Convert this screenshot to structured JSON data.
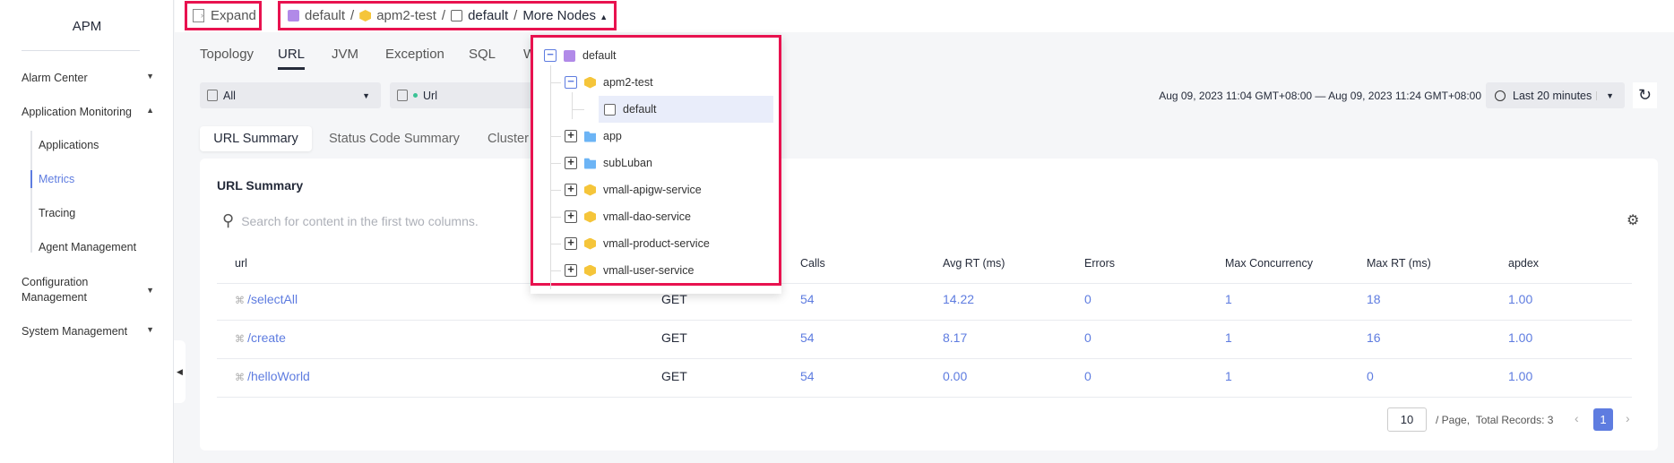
{
  "sidebar": {
    "title": "APM",
    "items": [
      {
        "label": "Alarm Center",
        "arrow": "▼"
      },
      {
        "label": "Application Monitoring",
        "arrow": "▲"
      },
      {
        "label": "Configuration Management",
        "arrow": "▼"
      },
      {
        "label": "System Management",
        "arrow": "▼"
      }
    ],
    "sub_items": [
      {
        "label": "Applications"
      },
      {
        "label": "Metrics",
        "active": true
      },
      {
        "label": "Tracing"
      },
      {
        "label": "Agent Management"
      }
    ]
  },
  "topbar": {
    "expand_label": "Expand",
    "breadcrumb": [
      {
        "label": "default",
        "icon": "environment-icon"
      },
      {
        "label": "apm2-test",
        "icon": "component-icon"
      },
      {
        "label": "default",
        "icon": "instance-icon"
      }
    ],
    "separator": "/",
    "more_nodes": "More Nodes"
  },
  "tabs": [
    {
      "label": "Topology"
    },
    {
      "label": "URL",
      "active": true
    },
    {
      "label": "JVM"
    },
    {
      "label": "Exception"
    },
    {
      "label": "SQL"
    },
    {
      "label": "W"
    }
  ],
  "filters": {
    "instance": "All",
    "type": "Url",
    "time_range": "Aug 09, 2023 11:04 GMT+08:00 — Aug 09, 2023 11:24 GMT+08:00",
    "time_preset": "Last 20 minutes"
  },
  "subtabs": [
    {
      "label": "URL Summary",
      "active": true
    },
    {
      "label": "Status Code Summary"
    },
    {
      "label": "Cluster"
    }
  ],
  "card": {
    "title": "URL Summary",
    "search_placeholder": "Search for content in the first two columns."
  },
  "table": {
    "columns": [
      "url",
      "Calls",
      "Avg RT (ms)",
      "Errors",
      "Max Concurrency",
      "Max RT (ms)",
      "apdex"
    ],
    "rows": [
      {
        "url": "/selectAll",
        "method": "GET",
        "calls": "54",
        "avg_rt": "14.22",
        "errors": "0",
        "max_conc": "1",
        "max_rt": "18",
        "apdex": "1.00"
      },
      {
        "url": "/create",
        "method": "GET",
        "calls": "54",
        "avg_rt": "8.17",
        "errors": "0",
        "max_conc": "1",
        "max_rt": "16",
        "apdex": "1.00"
      },
      {
        "url": "/helloWorld",
        "method": "GET",
        "calls": "54",
        "avg_rt": "0.00",
        "errors": "0",
        "max_conc": "1",
        "max_rt": "0",
        "apdex": "1.00"
      }
    ]
  },
  "pagination": {
    "page_size": "10",
    "page_label": "/ Page,",
    "total": "Total Records: 3",
    "current": "1"
  },
  "tree": [
    {
      "label": "default",
      "icon": "environment",
      "level": 0,
      "toggle": "−"
    },
    {
      "label": "apm2-test",
      "icon": "component",
      "level": 1,
      "toggle": "−"
    },
    {
      "label": "default",
      "icon": "instance",
      "level": 2,
      "selected": true
    },
    {
      "label": "app",
      "icon": "folder",
      "level": 1,
      "toggle": "+"
    },
    {
      "label": "subLuban",
      "icon": "folder",
      "level": 1,
      "toggle": "+"
    },
    {
      "label": "vmall-apigw-service",
      "icon": "component",
      "level": 1,
      "toggle": "+"
    },
    {
      "label": "vmall-dao-service",
      "icon": "component",
      "level": 1,
      "toggle": "+"
    },
    {
      "label": "vmall-product-service",
      "icon": "component",
      "level": 1,
      "toggle": "+"
    },
    {
      "label": "vmall-user-service",
      "icon": "component",
      "level": 1,
      "toggle": "+"
    }
  ],
  "colors": {
    "accent": "#5e7ce0",
    "highlight": "#e8124f"
  }
}
